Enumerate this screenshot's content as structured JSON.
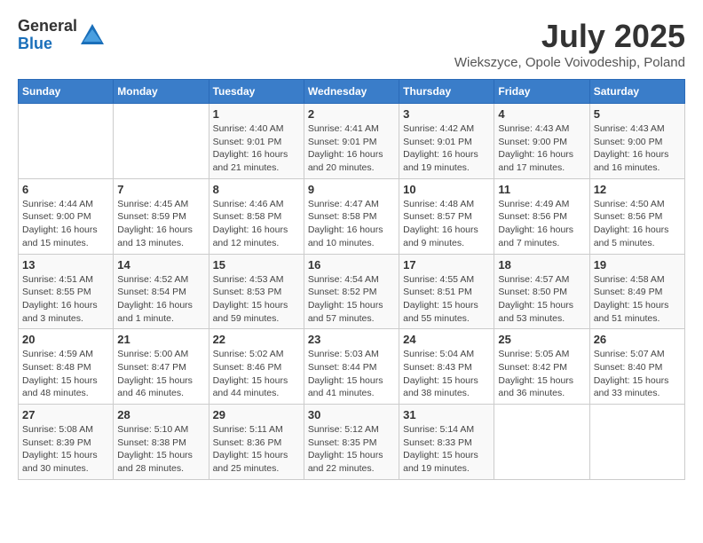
{
  "header": {
    "logo_general": "General",
    "logo_blue": "Blue",
    "month_title": "July 2025",
    "location": "Wiekszyce, Opole Voivodeship, Poland"
  },
  "weekdays": [
    "Sunday",
    "Monday",
    "Tuesday",
    "Wednesday",
    "Thursday",
    "Friday",
    "Saturday"
  ],
  "weeks": [
    [
      {
        "day": "",
        "info": ""
      },
      {
        "day": "",
        "info": ""
      },
      {
        "day": "1",
        "info": "Sunrise: 4:40 AM\nSunset: 9:01 PM\nDaylight: 16 hours and 21 minutes."
      },
      {
        "day": "2",
        "info": "Sunrise: 4:41 AM\nSunset: 9:01 PM\nDaylight: 16 hours and 20 minutes."
      },
      {
        "day": "3",
        "info": "Sunrise: 4:42 AM\nSunset: 9:01 PM\nDaylight: 16 hours and 19 minutes."
      },
      {
        "day": "4",
        "info": "Sunrise: 4:43 AM\nSunset: 9:00 PM\nDaylight: 16 hours and 17 minutes."
      },
      {
        "day": "5",
        "info": "Sunrise: 4:43 AM\nSunset: 9:00 PM\nDaylight: 16 hours and 16 minutes."
      }
    ],
    [
      {
        "day": "6",
        "info": "Sunrise: 4:44 AM\nSunset: 9:00 PM\nDaylight: 16 hours and 15 minutes."
      },
      {
        "day": "7",
        "info": "Sunrise: 4:45 AM\nSunset: 8:59 PM\nDaylight: 16 hours and 13 minutes."
      },
      {
        "day": "8",
        "info": "Sunrise: 4:46 AM\nSunset: 8:58 PM\nDaylight: 16 hours and 12 minutes."
      },
      {
        "day": "9",
        "info": "Sunrise: 4:47 AM\nSunset: 8:58 PM\nDaylight: 16 hours and 10 minutes."
      },
      {
        "day": "10",
        "info": "Sunrise: 4:48 AM\nSunset: 8:57 PM\nDaylight: 16 hours and 9 minutes."
      },
      {
        "day": "11",
        "info": "Sunrise: 4:49 AM\nSunset: 8:56 PM\nDaylight: 16 hours and 7 minutes."
      },
      {
        "day": "12",
        "info": "Sunrise: 4:50 AM\nSunset: 8:56 PM\nDaylight: 16 hours and 5 minutes."
      }
    ],
    [
      {
        "day": "13",
        "info": "Sunrise: 4:51 AM\nSunset: 8:55 PM\nDaylight: 16 hours and 3 minutes."
      },
      {
        "day": "14",
        "info": "Sunrise: 4:52 AM\nSunset: 8:54 PM\nDaylight: 16 hours and 1 minute."
      },
      {
        "day": "15",
        "info": "Sunrise: 4:53 AM\nSunset: 8:53 PM\nDaylight: 15 hours and 59 minutes."
      },
      {
        "day": "16",
        "info": "Sunrise: 4:54 AM\nSunset: 8:52 PM\nDaylight: 15 hours and 57 minutes."
      },
      {
        "day": "17",
        "info": "Sunrise: 4:55 AM\nSunset: 8:51 PM\nDaylight: 15 hours and 55 minutes."
      },
      {
        "day": "18",
        "info": "Sunrise: 4:57 AM\nSunset: 8:50 PM\nDaylight: 15 hours and 53 minutes."
      },
      {
        "day": "19",
        "info": "Sunrise: 4:58 AM\nSunset: 8:49 PM\nDaylight: 15 hours and 51 minutes."
      }
    ],
    [
      {
        "day": "20",
        "info": "Sunrise: 4:59 AM\nSunset: 8:48 PM\nDaylight: 15 hours and 48 minutes."
      },
      {
        "day": "21",
        "info": "Sunrise: 5:00 AM\nSunset: 8:47 PM\nDaylight: 15 hours and 46 minutes."
      },
      {
        "day": "22",
        "info": "Sunrise: 5:02 AM\nSunset: 8:46 PM\nDaylight: 15 hours and 44 minutes."
      },
      {
        "day": "23",
        "info": "Sunrise: 5:03 AM\nSunset: 8:44 PM\nDaylight: 15 hours and 41 minutes."
      },
      {
        "day": "24",
        "info": "Sunrise: 5:04 AM\nSunset: 8:43 PM\nDaylight: 15 hours and 38 minutes."
      },
      {
        "day": "25",
        "info": "Sunrise: 5:05 AM\nSunset: 8:42 PM\nDaylight: 15 hours and 36 minutes."
      },
      {
        "day": "26",
        "info": "Sunrise: 5:07 AM\nSunset: 8:40 PM\nDaylight: 15 hours and 33 minutes."
      }
    ],
    [
      {
        "day": "27",
        "info": "Sunrise: 5:08 AM\nSunset: 8:39 PM\nDaylight: 15 hours and 30 minutes."
      },
      {
        "day": "28",
        "info": "Sunrise: 5:10 AM\nSunset: 8:38 PM\nDaylight: 15 hours and 28 minutes."
      },
      {
        "day": "29",
        "info": "Sunrise: 5:11 AM\nSunset: 8:36 PM\nDaylight: 15 hours and 25 minutes."
      },
      {
        "day": "30",
        "info": "Sunrise: 5:12 AM\nSunset: 8:35 PM\nDaylight: 15 hours and 22 minutes."
      },
      {
        "day": "31",
        "info": "Sunrise: 5:14 AM\nSunset: 8:33 PM\nDaylight: 15 hours and 19 minutes."
      },
      {
        "day": "",
        "info": ""
      },
      {
        "day": "",
        "info": ""
      }
    ]
  ]
}
